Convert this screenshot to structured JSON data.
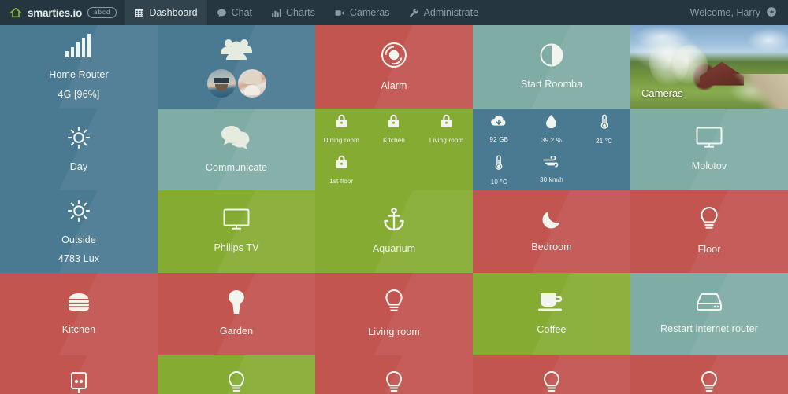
{
  "navbar": {
    "brand": "smarties.io",
    "brand_icon": "home-icon",
    "badge": "abcd",
    "items": [
      {
        "label": "Dashboard",
        "icon": "grid-icon",
        "active": true
      },
      {
        "label": "Chat",
        "icon": "comment-icon",
        "active": false
      },
      {
        "label": "Charts",
        "icon": "bar-chart-icon",
        "active": false
      },
      {
        "label": "Cameras",
        "icon": "video-camera-icon",
        "active": false
      },
      {
        "label": "Administrate",
        "icon": "wrench-icon",
        "active": false
      }
    ],
    "welcome": "Welcome, Harry",
    "signout_icon": "sign-out-icon"
  },
  "tiles": {
    "home_router": {
      "label": "Home Router",
      "value": "4G [96%]",
      "icon": "signal-bars-icon",
      "color": "#4a7a91"
    },
    "day": {
      "label": "Day",
      "icon": "sun-icon",
      "color": "#4a7a91"
    },
    "outside": {
      "label": "Outside",
      "value": "4783 Lux",
      "icon": "sun-icon",
      "color": "#4a7a91"
    },
    "users": {
      "icon": "users-group-icon",
      "color": "#4a7a91"
    },
    "communicate": {
      "label": "Communicate",
      "icon": "chat-bubbles-icon",
      "color": "#80aca6"
    },
    "alarm": {
      "label": "Alarm",
      "icon": "siren-icon",
      "color": "#c25550"
    },
    "start_roomba": {
      "label": "Start Roomba",
      "icon": "half-circle-icon",
      "color": "#80aca6"
    },
    "cameras": {
      "label": "Cameras",
      "icon": "photo-thumbnail"
    },
    "molotov": {
      "label": "Molotov",
      "icon": "tv-icon",
      "color": "#80aca6"
    },
    "philips_tv": {
      "label": "Philips TV",
      "icon": "tv-icon",
      "color": "#86ab33"
    },
    "aquarium": {
      "label": "Aquarium",
      "icon": "anchor-icon",
      "color": "#86ab33"
    },
    "bedroom": {
      "label": "Bedroom",
      "icon": "moon-icon",
      "color": "#c25550"
    },
    "floor": {
      "label": "Floor",
      "icon": "lightbulb-icon",
      "color": "#c25550"
    },
    "kitchen": {
      "label": "Kitchen",
      "icon": "burger-icon",
      "color": "#c25550"
    },
    "garden": {
      "label": "Garden",
      "icon": "tree-icon",
      "color": "#c25550"
    },
    "living_room": {
      "label": "Living room",
      "icon": "lightbulb-icon",
      "color": "#c25550"
    },
    "coffee": {
      "label": "Coffee",
      "icon": "coffee-cup-icon",
      "color": "#86ab33"
    },
    "restart_router": {
      "label": "Restart internet router",
      "icon": "server-icon",
      "color": "#80aca6"
    }
  },
  "locks": {
    "color": "#86ab33",
    "items": [
      {
        "label": "Dining room",
        "icon": "lock-icon"
      },
      {
        "label": "Kitchen",
        "icon": "lock-icon"
      },
      {
        "label": "Living room",
        "icon": "lock-icon"
      },
      {
        "label": "1st floor",
        "icon": "lock-icon"
      }
    ]
  },
  "sensors": {
    "color": "#4a7a91",
    "items": [
      {
        "label": "92 GB",
        "icon": "cloud-download-icon"
      },
      {
        "label": "39.2 %",
        "icon": "water-drop-icon"
      },
      {
        "label": "21 °C",
        "icon": "thermometer-icon"
      },
      {
        "label": "10 °C",
        "icon": "thermometer-icon"
      },
      {
        "label": "30 km/h",
        "icon": "wind-icon"
      }
    ]
  },
  "bottom_row": [
    {
      "label": "",
      "icon": "power-socket-icon",
      "color": "#c25550"
    },
    {
      "label": "",
      "icon": "lightbulb-icon",
      "color": "#86ab33"
    },
    {
      "label": "",
      "icon": "lightbulb-icon",
      "color": "#c25550"
    },
    {
      "label": "",
      "icon": "lightbulb-icon",
      "color": "#c25550"
    },
    {
      "label": "",
      "icon": "lightbulb-icon",
      "color": "#c25550"
    }
  ],
  "colors": {
    "navbar": "#253640",
    "blue": "#4a7a91",
    "green": "#86ab33",
    "red": "#c25550",
    "teal": "#80aca6",
    "text": "#f2f4ee"
  }
}
